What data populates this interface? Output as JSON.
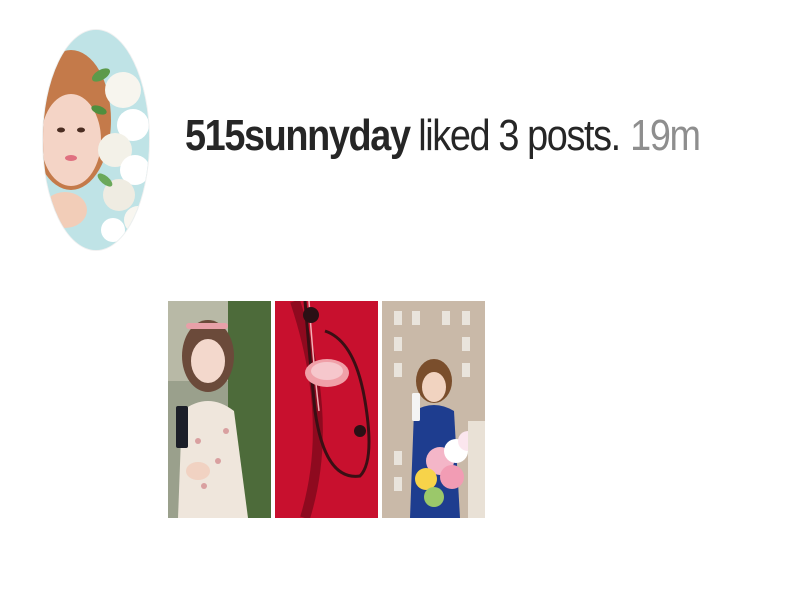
{
  "notification": {
    "username": "515sunnyday",
    "action": "liked 3 posts.",
    "timestamp": "19m"
  },
  "avatar": {
    "icon": "profile-photo"
  },
  "liked_posts": [
    {
      "icon": "post-thumbnail-woman-holding-phone"
    },
    {
      "icon": "post-thumbnail-red-stethoscope"
    },
    {
      "icon": "post-thumbnail-woman-with-flowers"
    }
  ],
  "colors": {
    "primary_text": "#262626",
    "secondary_text": "#8e8e8e",
    "background": "#ffffff"
  }
}
